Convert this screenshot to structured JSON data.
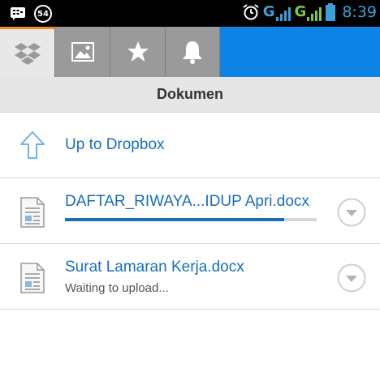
{
  "status_bar": {
    "notification_count": "54",
    "network_1": "G",
    "network_2": "G",
    "sim_label": "G",
    "signal_slot": "2",
    "time": "8:39"
  },
  "tabs": [
    {
      "name": "dropbox",
      "icon": "dropbox-icon",
      "active": true
    },
    {
      "name": "photos",
      "icon": "photo-icon",
      "active": false
    },
    {
      "name": "favorites",
      "icon": "star-icon",
      "active": false
    },
    {
      "name": "notifications",
      "icon": "bell-icon",
      "active": false
    }
  ],
  "title": "Dokumen",
  "list": {
    "up_label": "Up to Dropbox",
    "files": [
      {
        "name": "DAFTAR_RIWAYA...IDUP Apri.docx",
        "progress": 0.87,
        "status": ""
      },
      {
        "name": "Surat Lamaran Kerja.docx",
        "progress": null,
        "status": "Waiting to upload..."
      }
    ]
  },
  "colors": {
    "accent": "#0d83e6",
    "link": "#1a6ebc",
    "active_tab_top": "#f28c1e"
  }
}
